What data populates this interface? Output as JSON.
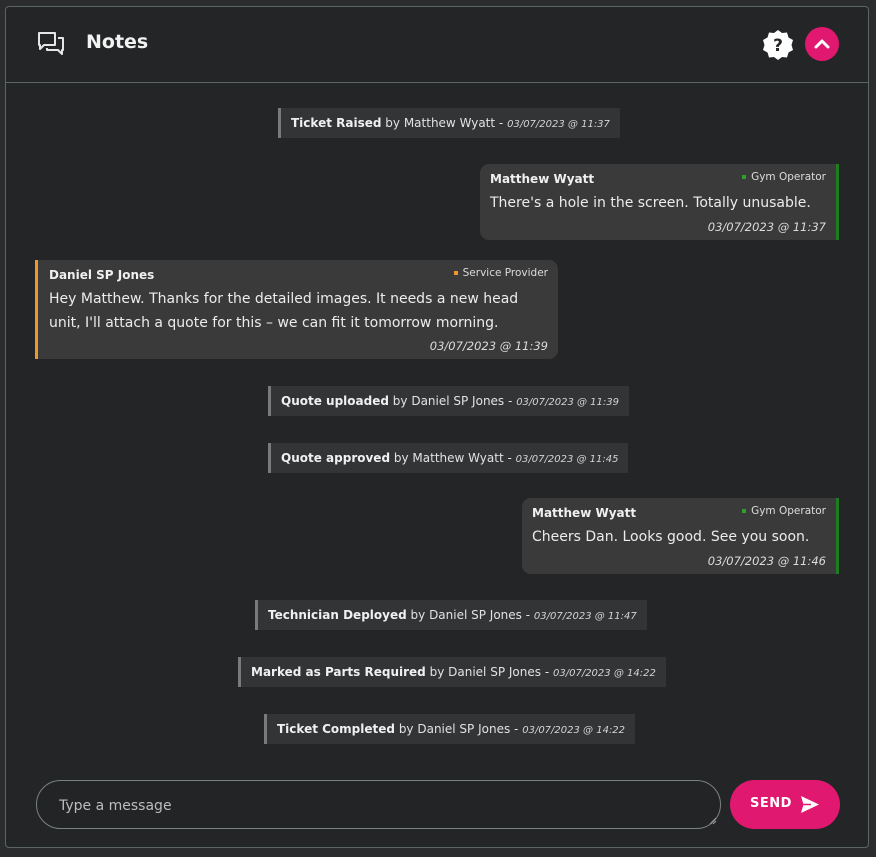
{
  "header": {
    "title": "Notes"
  },
  "events": [
    {
      "action": "Ticket Raised",
      "by": "by",
      "user": "Matthew Wyatt",
      "sep": "-",
      "time": "03/07/2023 @ 11:37"
    },
    {
      "action": "Quote uploaded",
      "by": "by",
      "user": "Daniel SP Jones",
      "sep": "-",
      "time": "03/07/2023 @ 11:39"
    },
    {
      "action": "Quote approved",
      "by": "by",
      "user": "Matthew Wyatt",
      "sep": "-",
      "time": "03/07/2023 @ 11:45"
    },
    {
      "action": "Technician Deployed",
      "by": "by",
      "user": "Daniel SP Jones",
      "sep": "-",
      "time": "03/07/2023 @ 11:47"
    },
    {
      "action": "Marked as Parts Required",
      "by": "by",
      "user": "Daniel SP Jones",
      "sep": "-",
      "time": "03/07/2023 @ 14:22"
    },
    {
      "action": "Ticket Completed",
      "by": "by",
      "user": "Daniel SP Jones",
      "sep": "-",
      "time": "03/07/2023 @ 14:22"
    }
  ],
  "messages": [
    {
      "author": "Matthew Wyatt",
      "role": "Gym Operator",
      "role_color": "#2e9e2e",
      "lines": [
        "There's a hole in the screen. Totally unusable."
      ],
      "time": "03/07/2023 @ 11:37"
    },
    {
      "author": "Daniel SP Jones",
      "role": "Service Provider",
      "role_color": "#f0962c",
      "lines": [
        "Hey Matthew. Thanks for the detailed images. It needs a new head",
        "unit, I'll attach a quote for this – we can fit it tomorrow morning."
      ],
      "time": "03/07/2023 @ 11:39"
    },
    {
      "author": "Matthew Wyatt",
      "role": "Gym Operator",
      "role_color": "#2e9e2e",
      "lines": [
        "Cheers Dan. Looks good. See you soon."
      ],
      "time": "03/07/2023 @ 11:46"
    }
  ],
  "composer": {
    "placeholder": "Type a message",
    "send_label": "SEND"
  },
  "colors": {
    "accent": "#e0186f",
    "operator": "#1e7d1e",
    "provider": "#f0962c"
  }
}
